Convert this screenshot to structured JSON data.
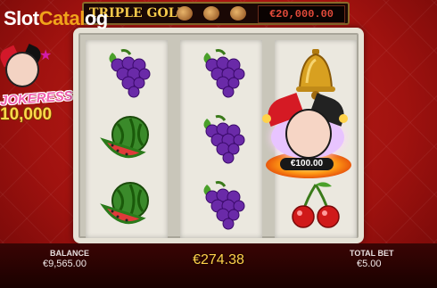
{
  "watermark": {
    "part1": "Slot",
    "part2": "Catal",
    "part3": "og"
  },
  "jackpot": {
    "title": "TRIPLE GOLD",
    "amount": "€20,000.00"
  },
  "logo": {
    "name": "JOKERESS",
    "amount": "10,000"
  },
  "reels": [
    [
      "grapes",
      "watermelon",
      "watermelon"
    ],
    [
      "grapes",
      "grapes",
      "grapes"
    ],
    [
      "bell",
      "joker-jackpot",
      "cherries"
    ]
  ],
  "joker_prize": "€100.00",
  "balance": {
    "label": "BALANCE",
    "value": "€9,565.00"
  },
  "win": "€274.38",
  "total_bet": {
    "label": "TOTAL BET",
    "value": "€5.00"
  },
  "colors": {
    "background": "#b0150f",
    "frame": "#e6e2d6",
    "gold": "#ffd24a"
  }
}
